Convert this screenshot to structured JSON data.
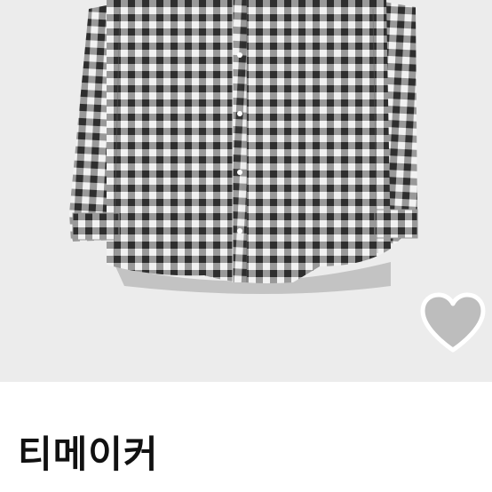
{
  "product": {
    "brand": "티메이커"
  },
  "colors": {
    "image_background": "#ececec",
    "heart_fill": "#bdbdbd",
    "heart_stroke": "#ffffff",
    "text": "#111111"
  },
  "icons": {
    "wishlist": "heart-icon"
  }
}
